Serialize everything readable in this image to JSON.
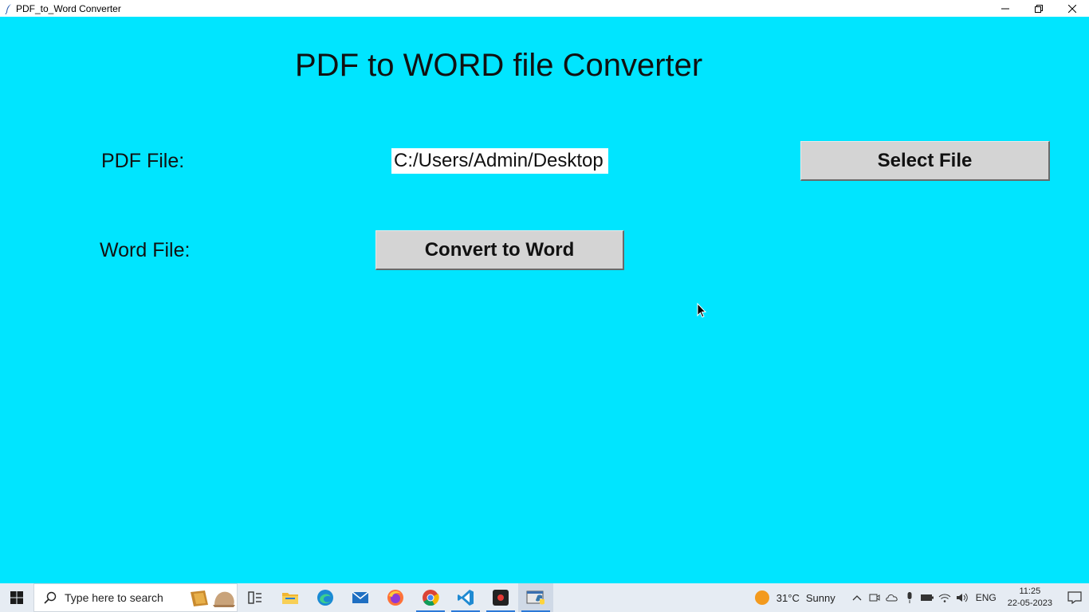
{
  "window": {
    "title": "PDF_to_Word Converter",
    "controls": [
      "minimize",
      "restore",
      "close"
    ]
  },
  "app": {
    "background": "#00e5ff",
    "heading": "PDF to WORD file Converter",
    "pdf_label": "PDF File:",
    "pdf_path_value": "C:/Users/Admin/Desktop",
    "select_button": "Select File",
    "word_label": "Word File:",
    "convert_button": "Convert to Word"
  },
  "taskbar": {
    "search_placeholder": "Type here to search",
    "pinned_icons": [
      "widgets-icon",
      "task-view-icon",
      "file-explorer-icon",
      "edge-icon",
      "mail-icon",
      "firefox-icon",
      "chrome-icon",
      "vscode-icon",
      "recorder-icon",
      "python-idle-icon"
    ],
    "weather": {
      "temperature": "31°C",
      "condition": "Sunny"
    },
    "language": "ENG",
    "time": "11:25",
    "date": "22-05-2023"
  }
}
